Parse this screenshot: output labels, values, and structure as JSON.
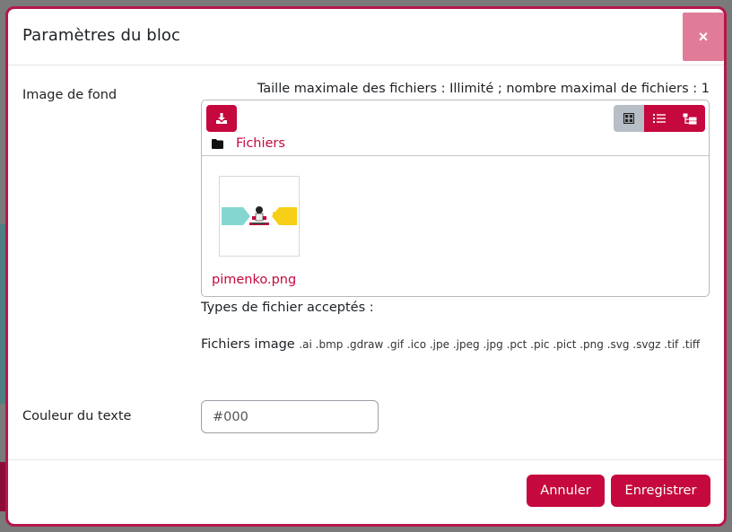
{
  "modal": {
    "title": "Paramètres du bloc",
    "close_glyph": "×"
  },
  "background_image": {
    "label": "Image de fond",
    "size_info": "Taille maximale des fichiers : Illimité ; nombre maximal de fichiers : 1",
    "folder_name": "Fichiers",
    "files": [
      {
        "name": "pimenko.png"
      }
    ],
    "accepted_types_title": "Types de fichier acceptés :",
    "accepted_types_group": "Fichiers image",
    "accepted_extensions": ".ai .bmp .gdraw .gif .ico .jpe .jpeg .jpg .pct .pic .pict .png .svg .svgz .tif .tiff"
  },
  "text_color": {
    "label": "Couleur du texte",
    "placeholder": "#000",
    "value": ""
  },
  "footer": {
    "cancel_label": "Annuler",
    "save_label": "Enregistrer"
  },
  "colors": {
    "accent": "#c5083d",
    "close_button": "#e17c98",
    "modal_border": "#b5174a"
  },
  "icons": {
    "add": "download-icon",
    "view_grid": "grid-icon",
    "view_list": "list-icon",
    "view_tree": "tree-icon",
    "folder": "folder-icon",
    "close": "close-icon"
  }
}
